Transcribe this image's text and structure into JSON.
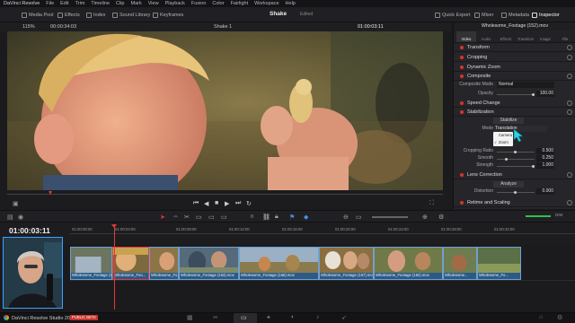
{
  "menubar": {
    "items": [
      "DaVinci Resolve",
      "File",
      "Edit",
      "Trim",
      "Timeline",
      "Clip",
      "Mark",
      "View",
      "Playback",
      "Fusion",
      "Color",
      "Fairlight",
      "Workspace",
      "Help"
    ]
  },
  "toolbar": {
    "media_pool": "Media Pool",
    "effects": "Effects",
    "index": "Index",
    "sound_library": "Sound Library",
    "keyframes": "Keyframes",
    "project_title": "Shake",
    "project_status": "Edited",
    "quick_export": "Quick Export",
    "mixer": "Mixer",
    "metadata": "Metadata",
    "inspector": "Inspector"
  },
  "viewer": {
    "zoom": "115%",
    "timecode_left": "00:00:34:03",
    "clip_name": "Shake 1",
    "timecode_right": "01:00:03:11"
  },
  "inspector": {
    "clip_title": "Wholesome_Footage (152).mov",
    "tabs": [
      "Video",
      "Audio",
      "Effects",
      "Transition",
      "Image",
      "File"
    ],
    "sections": {
      "transform": "Transform",
      "cropping": "Cropping",
      "dynamic_zoom": "Dynamic Zoom",
      "composite": "Composite",
      "speed_change": "Speed Change",
      "stabilization": "Stabilization",
      "lens_correction": "Lens Correction",
      "retime": "Retime and Scaling"
    },
    "composite_mode_label": "Composite Mode",
    "composite_mode_value": "Normal",
    "opacity_label": "Opacity",
    "opacity_value": "100.00",
    "stabilize_button": "Stabilize",
    "mode_label": "Mode",
    "mode_value": "Translation",
    "mode_options": [
      "Camera",
      "Zoom"
    ],
    "cropping_ratio_label": "Cropping Ratio",
    "cropping_ratio_value": "0.500",
    "smooth_label": "Smooth",
    "smooth_value": "0.250",
    "strength_label": "Strength",
    "strength_value": "1.000",
    "analyze_button": "Analyze",
    "distortion_label": "Distortion",
    "distortion_value": "0.000"
  },
  "timeline": {
    "timecode": "01:00:03:11",
    "ruler": [
      "01:00:00:00",
      "01:00:04:00",
      "01:00:08:00",
      "01:00:12:00",
      "01:00:16:00",
      "01:00:20:00",
      "01:00:24:00",
      "01:00:28:00",
      "01:00:32:00"
    ],
    "zoom_label": "DIM",
    "clips": [
      "Wholesome_Footage (1...",
      "Wholesome_Foo...",
      "Wholesome_Fo...",
      "Wholesome_Footage (153).mov",
      "Wholesome_Footage (156).mov",
      "Wholesome_Footage (157).mov",
      "Wholesome_Footage (162).mov",
      "Wholesome...",
      "Wholesome_Fo..."
    ]
  },
  "footer": {
    "app_name": "DaVinci Resolve Studio 20",
    "badge": "PUBLIC BETA"
  },
  "colors": {
    "accent": "#d8332c",
    "clip_blue": "#2b5a86",
    "playhead": "#e23b30",
    "cursor": "#2fd0e0"
  }
}
